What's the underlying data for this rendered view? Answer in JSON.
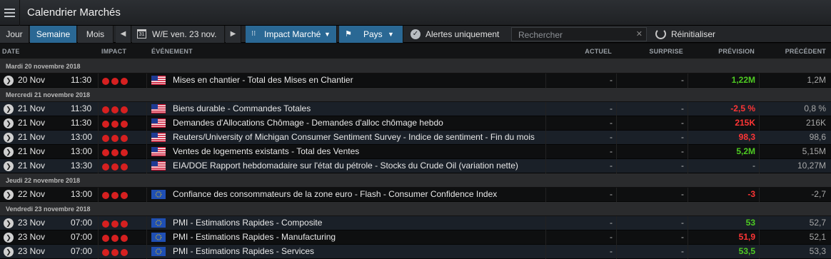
{
  "app": {
    "title": "Calendrier Marchés"
  },
  "toolbar": {
    "periods": [
      "Jour",
      "Semaine",
      "Mois"
    ],
    "active_period": "Semaine",
    "date_label": "W/E ven. 23 nov.",
    "calendar_day": "31",
    "impact_label": "Impact Marché",
    "country_label": "Pays",
    "alerts_label": "Alertes uniquement",
    "search_placeholder": "Rechercher",
    "reset_label": "Réinitialiser"
  },
  "columns": {
    "date": "DATE",
    "impact": "IMPACT",
    "event": "ÉVÉNEMENT",
    "actual": "ACTUEL",
    "surprise": "SURPRISE",
    "forecast": "PRÉVISION",
    "previous": "PRÉCÉDENT"
  },
  "colors": {
    "accent": "#2a6894",
    "positive": "#4ecb22",
    "negative": "#ff3535",
    "impact_high": "#d62020"
  },
  "groups": [
    {
      "label": "Mardi 20 novembre 2018",
      "events": [
        {
          "date": "20 Nov",
          "time": "11:30",
          "impact": 3,
          "flag": "us-flag-icon",
          "event": "Mises en chantier - Total des Mises en Chantier",
          "actual": "-",
          "surprise": "-",
          "forecast": "1,22M",
          "forecast_tone": "green",
          "previous": "1,2M"
        }
      ]
    },
    {
      "label": "Mercredi 21 novembre 2018",
      "events": [
        {
          "date": "21 Nov",
          "time": "11:30",
          "impact": 3,
          "flag": "us-flag-icon",
          "event": "Biens durable - Commandes Totales",
          "actual": "-",
          "surprise": "-",
          "forecast": "-2,5 %",
          "forecast_tone": "red",
          "previous": "0,8 %"
        },
        {
          "date": "21 Nov",
          "time": "11:30",
          "impact": 3,
          "flag": "us-flag-icon",
          "event": "Demandes d'Allocations Chômage - Demandes d'alloc chômage hebdo",
          "actual": "-",
          "surprise": "-",
          "forecast": "215K",
          "forecast_tone": "red",
          "previous": "216K"
        },
        {
          "date": "21 Nov",
          "time": "13:00",
          "impact": 3,
          "flag": "us-flag-icon",
          "event": "Reuters/University of Michigan Consumer Sentiment Survey - Indice de sentiment - Fin du mois",
          "actual": "-",
          "surprise": "-",
          "forecast": "98,3",
          "forecast_tone": "red",
          "previous": "98,6"
        },
        {
          "date": "21 Nov",
          "time": "13:00",
          "impact": 3,
          "flag": "us-flag-icon",
          "event": "Ventes de logements existants - Total des Ventes",
          "actual": "-",
          "surprise": "-",
          "forecast": "5,2M",
          "forecast_tone": "green",
          "previous": "5,15M"
        },
        {
          "date": "21 Nov",
          "time": "13:30",
          "impact": 3,
          "flag": "us-flag-icon",
          "event": "EIA/DOE Rapport hebdomadaire sur l'état du pétrole - Stocks du Crude Oil (variation nette)",
          "actual": "-",
          "surprise": "-",
          "forecast": "-",
          "forecast_tone": "dash",
          "previous": "10,27M"
        }
      ]
    },
    {
      "label": "Jeudi 22 novembre 2018",
      "events": [
        {
          "date": "22 Nov",
          "time": "13:00",
          "impact": 3,
          "flag": "eu-flag-icon",
          "event": "Confiance des consommateurs de la zone euro - Flash - Consumer Confidence Index",
          "actual": "-",
          "surprise": "-",
          "forecast": "-3",
          "forecast_tone": "red",
          "previous": "-2,7"
        }
      ]
    },
    {
      "label": "Vendredi 23 novembre 2018",
      "events": [
        {
          "date": "23 Nov",
          "time": "07:00",
          "impact": 3,
          "flag": "eu-flag-icon",
          "event": "PMI - Estimations Rapides - Composite",
          "actual": "-",
          "surprise": "-",
          "forecast": "53",
          "forecast_tone": "green",
          "previous": "52,7"
        },
        {
          "date": "23 Nov",
          "time": "07:00",
          "impact": 3,
          "flag": "eu-flag-icon",
          "event": "PMI - Estimations Rapides - Manufacturing",
          "actual": "-",
          "surprise": "-",
          "forecast": "51,9",
          "forecast_tone": "red",
          "previous": "52,1"
        },
        {
          "date": "23 Nov",
          "time": "07:00",
          "impact": 3,
          "flag": "eu-flag-icon",
          "event": "PMI - Estimations Rapides - Services",
          "actual": "-",
          "surprise": "-",
          "forecast": "53,5",
          "forecast_tone": "green",
          "previous": "53,3"
        }
      ]
    }
  ]
}
